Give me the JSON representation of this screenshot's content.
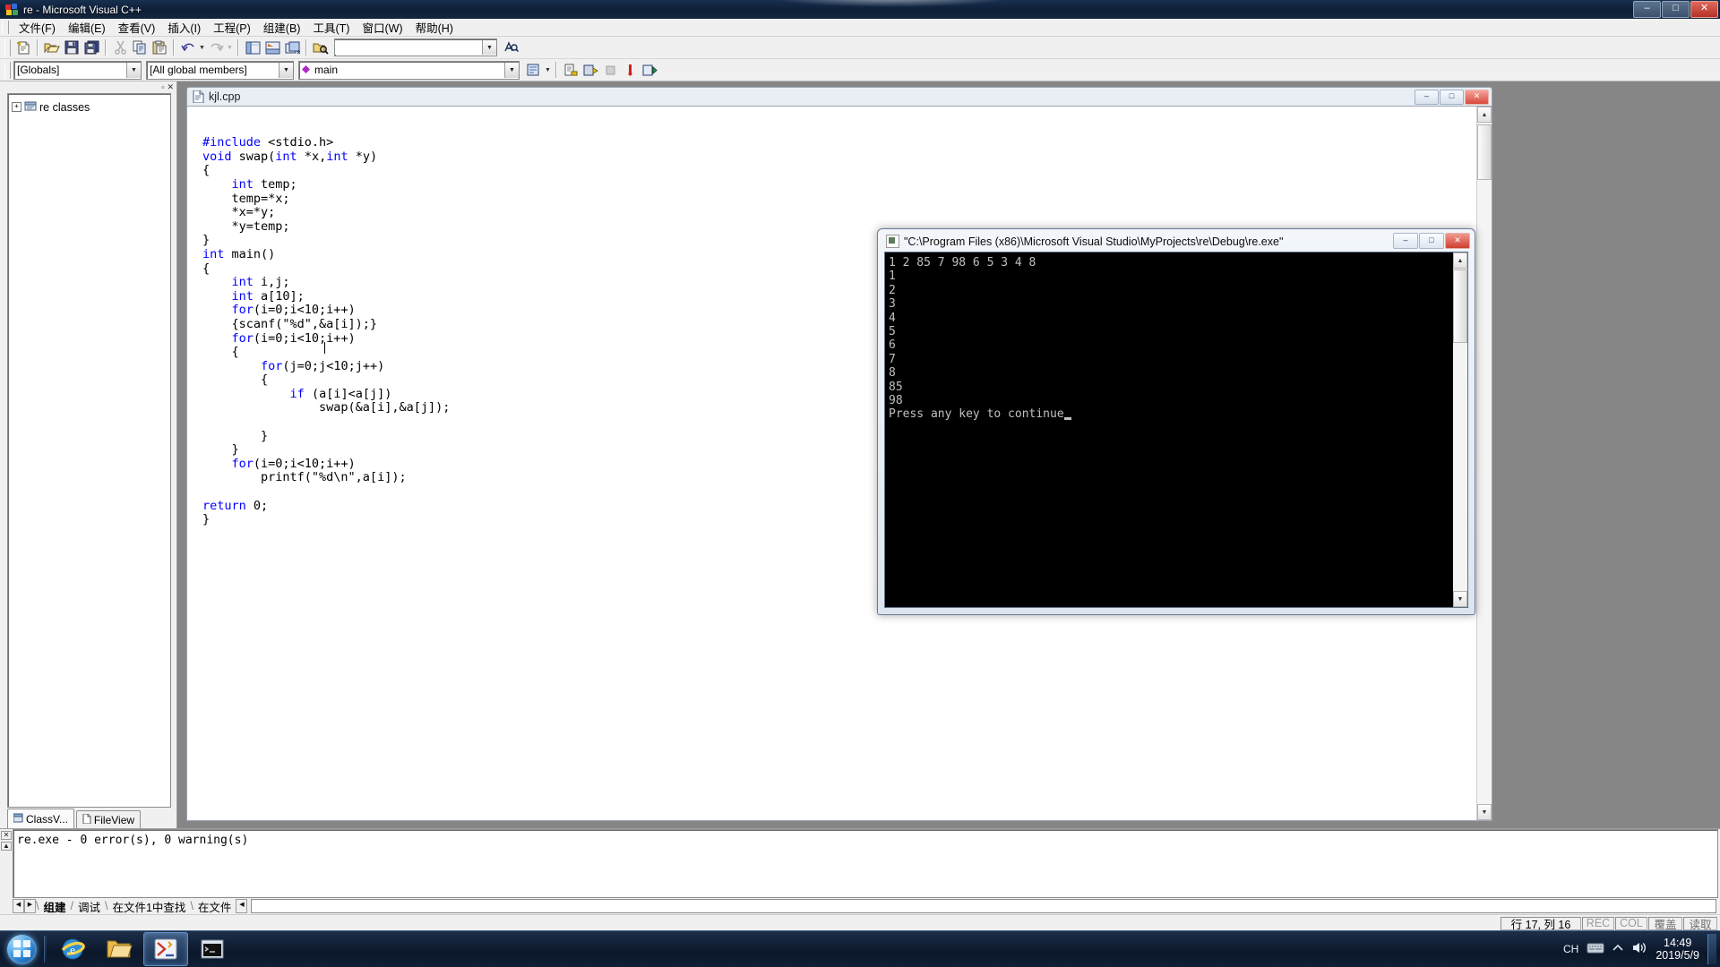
{
  "window": {
    "title": "re - Microsoft Visual C++",
    "buttons": {
      "minimize": "–",
      "maximize": "□",
      "close": "✕"
    }
  },
  "menu": {
    "items": [
      {
        "label": "文件(F)",
        "name": "menu-file"
      },
      {
        "label": "编辑(E)",
        "name": "menu-edit"
      },
      {
        "label": "查看(V)",
        "name": "menu-view"
      },
      {
        "label": "插入(I)",
        "name": "menu-insert"
      },
      {
        "label": "工程(P)",
        "name": "menu-project"
      },
      {
        "label": "组建(B)",
        "name": "menu-build"
      },
      {
        "label": "工具(T)",
        "name": "menu-tools"
      },
      {
        "label": "窗口(W)",
        "name": "menu-window"
      },
      {
        "label": "帮助(H)",
        "name": "menu-help"
      }
    ]
  },
  "toolbar": {
    "find_placeholder": "",
    "find_value": ""
  },
  "wizardbar": {
    "scope": "[Globals]",
    "members": "[All global members]",
    "symbol": "main"
  },
  "classview": {
    "root": "re classes",
    "expander": "+",
    "tabs": [
      {
        "label": "ClassV...",
        "name": "tab-class-view"
      },
      {
        "label": "FileView",
        "name": "tab-file-view"
      }
    ]
  },
  "editor": {
    "tab_title": "kjl.cpp",
    "buttons": {
      "minimize": "–",
      "maximize": "□",
      "close": "✕"
    },
    "code_lines": [
      "#include <stdio.h>",
      "void swap(int *x,int *y)",
      "{",
      "    int temp;",
      "    temp=*x;",
      "    *x=*y;",
      "    *y=temp;",
      "}",
      "int main()",
      "{",
      "    int i,j;",
      "    int a[10];",
      "    for(i=0;i<10;i++)",
      "    {scanf(\"%d\",&a[i]);}",
      "    for(i=0;i<10;i++)",
      "    {",
      "        for(j=0;j<10;j++)",
      "        {",
      "            if (a[i]<a[j])",
      "                swap(&a[i],&a[j]);",
      "",
      "        }",
      "    }",
      "    for(i=0;i<10;i++)",
      "        printf(\"%d\\n\",a[i]);",
      "",
      "return 0;",
      "}"
    ]
  },
  "console": {
    "title": "\"C:\\Program Files (x86)\\Microsoft Visual Studio\\MyProjects\\re\\Debug\\re.exe\"",
    "buttons": {
      "minimize": "–",
      "maximize": "□",
      "close": "✕"
    },
    "output_lines": [
      "1 2 85 7 98 6 5 3 4 8",
      "1",
      "2",
      "3",
      "4",
      "5",
      "6",
      "7",
      "8",
      "85",
      "98",
      "Press any key to continue"
    ]
  },
  "output_pane": {
    "text": "re.exe - 0 error(s), 0 warning(s)",
    "tabs": [
      {
        "label": "组建",
        "name": "output-tab-build"
      },
      {
        "label": "调试",
        "name": "output-tab-debug"
      },
      {
        "label": "在文件1中查找",
        "name": "output-tab-find1"
      },
      {
        "label": "在文件",
        "name": "output-tab-find2"
      }
    ]
  },
  "statusbar": {
    "message": "",
    "position": "行 17, 列 16",
    "rec": "REC",
    "col": "COL",
    "ovr": "覆盖",
    "read": "读取"
  },
  "taskbar": {
    "start": "start-orb",
    "items": [
      {
        "name": "taskbar-ie",
        "icon": "internet-explorer-icon"
      },
      {
        "name": "taskbar-explorer",
        "icon": "folder-icon"
      },
      {
        "name": "taskbar-vc",
        "icon": "visual-cpp-icon"
      },
      {
        "name": "taskbar-console",
        "icon": "console-window-icon"
      }
    ],
    "tray": {
      "ime": "CH",
      "time": "14:49",
      "date": "2019/5/9"
    }
  },
  "colors": {
    "keyword": "#0000ff",
    "titlebar": "#0d1e36",
    "console_bg": "#000000",
    "console_fg": "#c0c0c0"
  }
}
